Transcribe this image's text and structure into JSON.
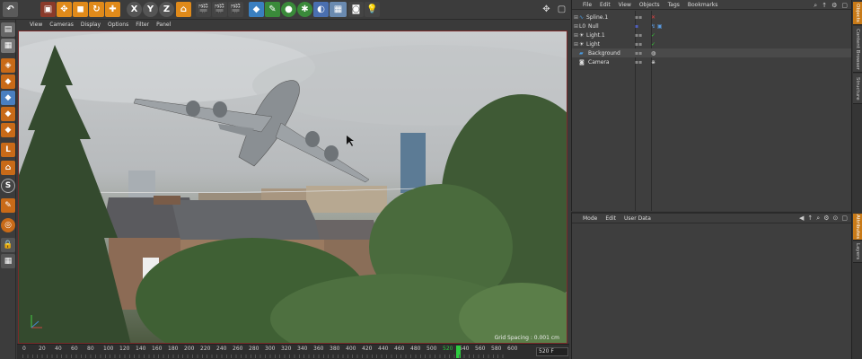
{
  "toolbar": {
    "undo_icon": "undo-icon",
    "axis_x": "X",
    "axis_y": "Y",
    "axis_z": "Z"
  },
  "viewport_menu": [
    "View",
    "Cameras",
    "Display",
    "Options",
    "Filter",
    "Panel"
  ],
  "viewport": {
    "grid_spacing_label": "Grid Spacing : 0.001 cm"
  },
  "timeline": {
    "ticks": [
      "0",
      "20",
      "40",
      "60",
      "80",
      "100",
      "120",
      "140",
      "160",
      "180",
      "200",
      "220",
      "240",
      "260",
      "280",
      "300",
      "320",
      "340",
      "360",
      "380",
      "400",
      "420",
      "440",
      "460",
      "480",
      "500",
      "520",
      "540",
      "560",
      "580",
      "600"
    ],
    "current_frame": "520",
    "end_frame": "520 F"
  },
  "object_manager": {
    "menu": [
      "File",
      "Edit",
      "View",
      "Objects",
      "Tags",
      "Bookmarks"
    ],
    "objects": [
      {
        "name": "Spline.1"
      },
      {
        "name": "Null"
      },
      {
        "name": "Light.1"
      },
      {
        "name": "Light"
      },
      {
        "name": "Background"
      },
      {
        "name": "Camera"
      }
    ]
  },
  "attribute_manager": {
    "menu": [
      "Mode",
      "Edit",
      "User Data"
    ]
  },
  "side_tabs": [
    "Objects",
    "Content Browser",
    "Structure",
    "Attributes",
    "Layers"
  ],
  "colors": {
    "accent_orange": "#e08a1a",
    "active_tab": "#c87a18",
    "viewport_border": "#7a2a2a",
    "timeline_marker": "#2ecc40"
  }
}
